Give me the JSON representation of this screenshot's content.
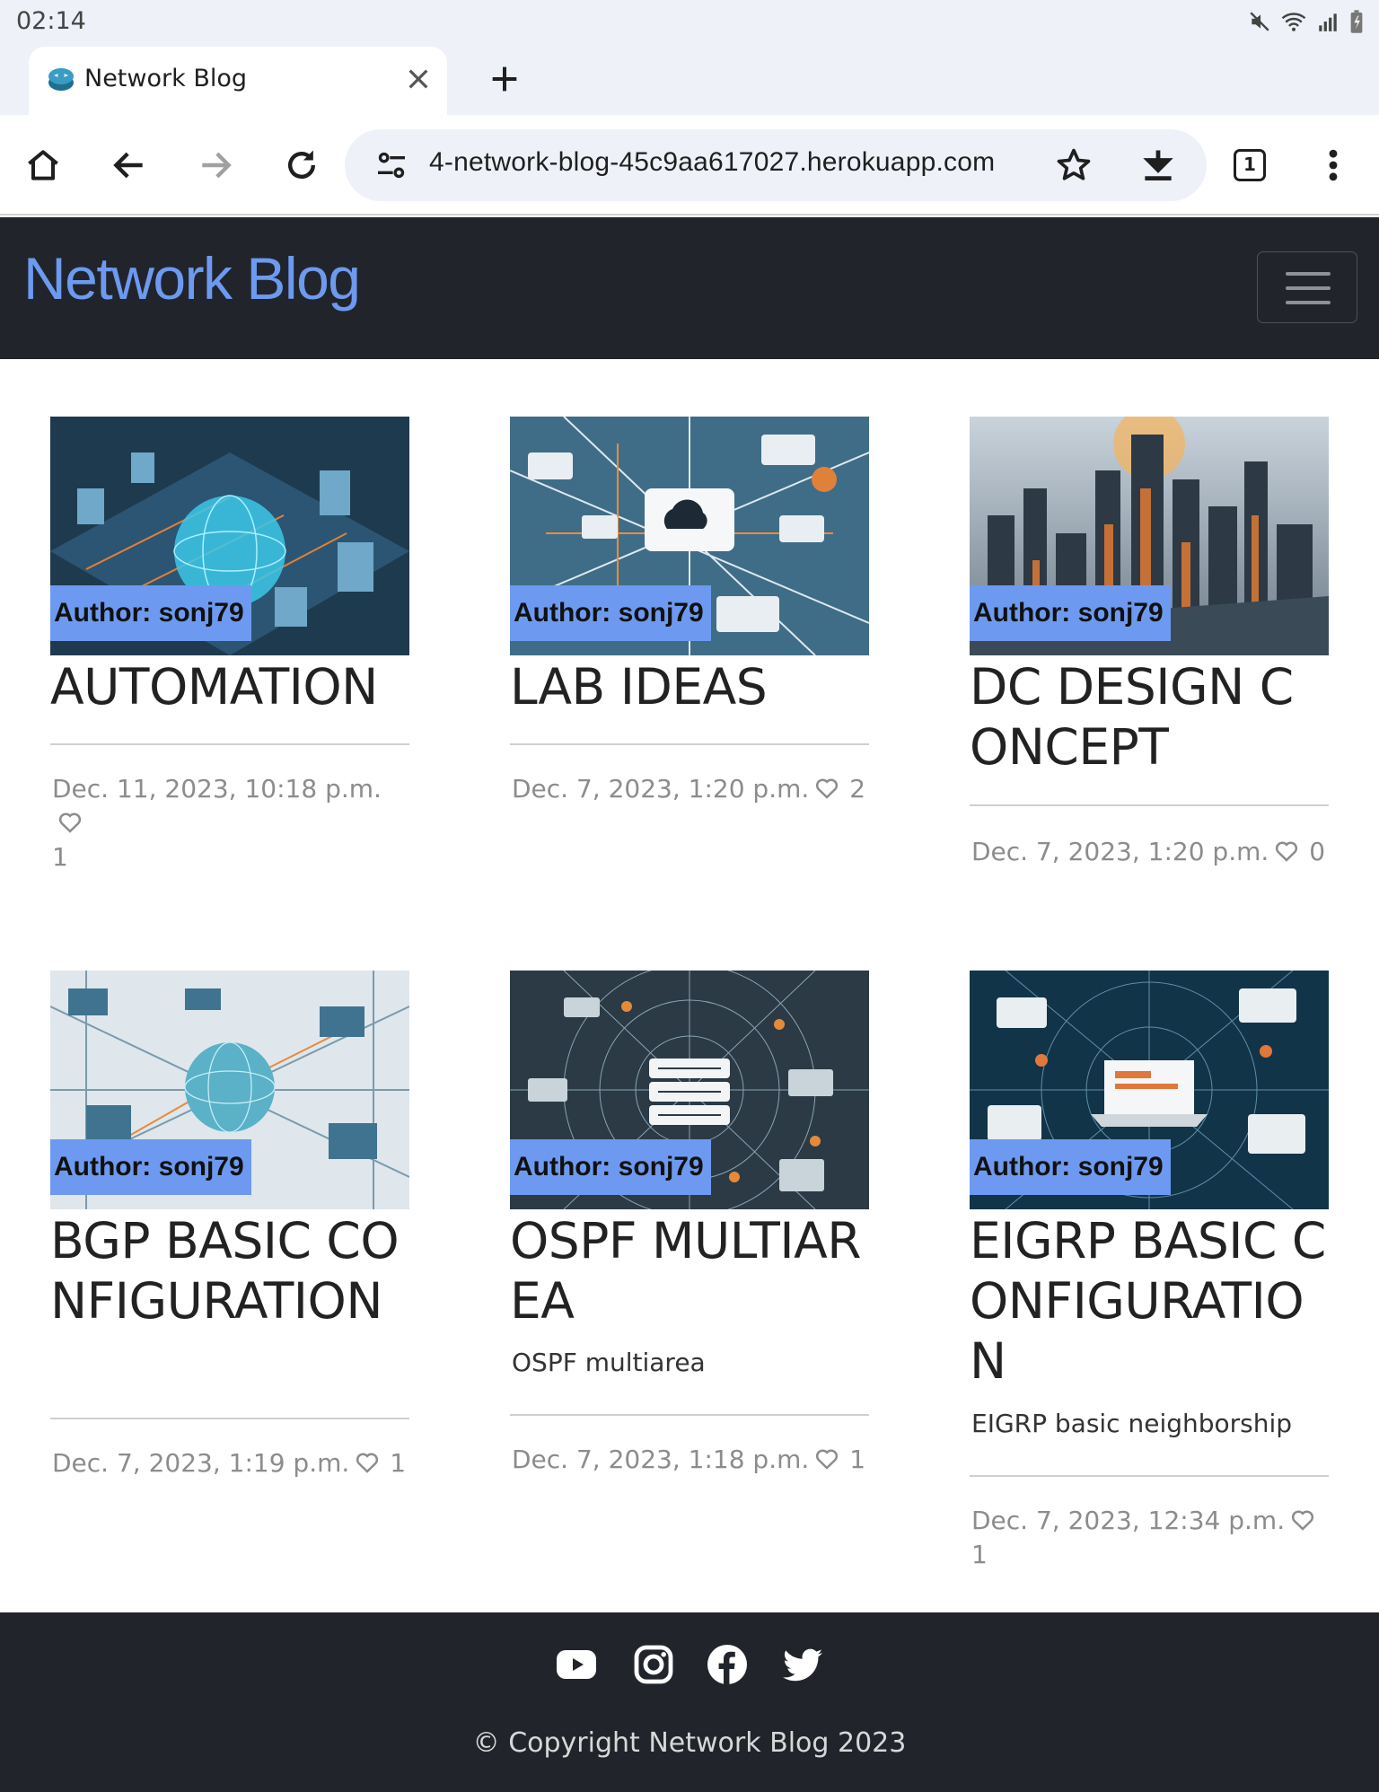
{
  "status_bar": {
    "time": "02:14"
  },
  "browser": {
    "tab_title": "Network Blog",
    "url": "4-network-blog-45c9aa617027.herokuapp.com",
    "tab_count": "1"
  },
  "navbar": {
    "brand": "Network Blog"
  },
  "posts": [
    {
      "author": "Author: sonj79",
      "title": "AUTOMATION",
      "excerpt": "",
      "date": "Dec. 11, 2023, 10:18 p.m.",
      "likes": "1",
      "image": "city-sphere"
    },
    {
      "author": "Author: sonj79",
      "title": "LAB IDEAS",
      "excerpt": "",
      "date": "Dec. 7, 2023, 1:20 p.m.",
      "likes": "2",
      "image": "cloud-network"
    },
    {
      "author": "Author: sonj79",
      "title": "DC DESIGN CONCEPT",
      "excerpt": "",
      "date": "Dec. 7, 2023, 1:20 p.m.",
      "likes": "0",
      "image": "skyline"
    },
    {
      "author": "Author: sonj79",
      "title": "BGP BASIC CONFIGURATION",
      "excerpt": "",
      "date": "Dec. 7, 2023, 1:19 p.m.",
      "likes": "1",
      "image": "globe-network"
    },
    {
      "author": "Author: sonj79",
      "title": "OSPF MULTIAREA",
      "excerpt": "OSPF multiarea",
      "date": "Dec. 7, 2023, 1:18 p.m.",
      "likes": "1",
      "image": "router-hub"
    },
    {
      "author": "Author: sonj79",
      "title": "EIGRP BASIC CONFIGURATION",
      "excerpt": "EIGRP basic neighborship",
      "date": "Dec. 7, 2023, 12:34 p.m.",
      "likes": "1",
      "image": "laptop-web"
    }
  ],
  "footer": {
    "social": [
      "youtube-icon",
      "instagram-icon",
      "facebook-icon",
      "twitter-icon"
    ],
    "copyright": "© Copyright Network Blog 2023"
  },
  "colors": {
    "navbar_bg": "#21252b",
    "brand": "#6d9af0",
    "author_badge": "#6d9af0",
    "footer_bg": "#21252b"
  }
}
